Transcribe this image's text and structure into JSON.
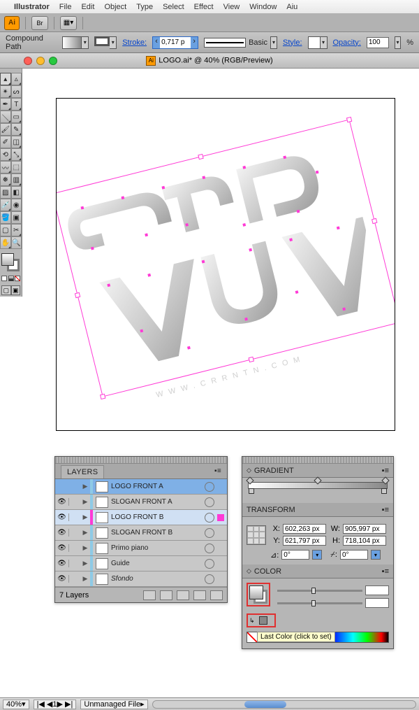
{
  "menubar": {
    "app": "Illustrator",
    "items": [
      "File",
      "Edit",
      "Object",
      "Type",
      "Select",
      "Effect",
      "View",
      "Window",
      "Aiu"
    ]
  },
  "apptoolbar": {
    "ai": "Ai",
    "br": "Br"
  },
  "controlbar": {
    "selection": "Compound Path",
    "stroke_label": "Stroke:",
    "stroke_value": "0,717 p",
    "brush_name": "Basic",
    "style_label": "Style:",
    "opacity_label": "Opacity:",
    "opacity_value": "100",
    "opacity_unit": "%"
  },
  "titlebar": {
    "title": "LOGO.ai* @ 40% (RGB/Preview)"
  },
  "artwork": {
    "url_text": "WWW.CRRNTN.COM"
  },
  "layers_panel": {
    "title": "LAYERS",
    "footer": "7 Layers",
    "rows": [
      {
        "name": "LOGO FRONT A",
        "color": "#8ecae6",
        "eye": "",
        "sel": 1,
        "italic": false,
        "selind": ""
      },
      {
        "name": "SLOGAN FRONT A",
        "color": "#8ecae6",
        "eye": "👁",
        "sel": 0,
        "italic": false,
        "selind": ""
      },
      {
        "name": "LOGO FRONT B",
        "color": "#ff3ad6",
        "eye": "👁",
        "sel": 2,
        "italic": false,
        "selind": "#ff3ad6"
      },
      {
        "name": "SLOGAN FRONT B",
        "color": "#8ecae6",
        "eye": "👁",
        "sel": 0,
        "italic": false,
        "selind": ""
      },
      {
        "name": "Primo piano",
        "color": "#8ecae6",
        "eye": "👁",
        "sel": 0,
        "italic": false,
        "selind": ""
      },
      {
        "name": "Guide",
        "color": "#8ecae6",
        "eye": "👁",
        "sel": 0,
        "italic": false,
        "selind": ""
      },
      {
        "name": "Sfondo",
        "color": "#8ecae6",
        "eye": "👁",
        "sel": 0,
        "italic": true,
        "selind": ""
      }
    ]
  },
  "gradient_panel": {
    "title": "GRADIENT"
  },
  "transform_panel": {
    "title": "TRANSFORM",
    "x_label": "X:",
    "x": "602,263 px",
    "y_label": "Y:",
    "y": "621,797 px",
    "w_label": "W:",
    "w": "905,997 px",
    "h_label": "H:",
    "h": "718,104 px",
    "rotate": "0°",
    "shear": "0°"
  },
  "color_panel": {
    "title": "COLOR",
    "tooltip": "Last Color (click to set)"
  },
  "statusbar": {
    "zoom": "40%",
    "page": "1",
    "status": "Unmanaged File"
  }
}
